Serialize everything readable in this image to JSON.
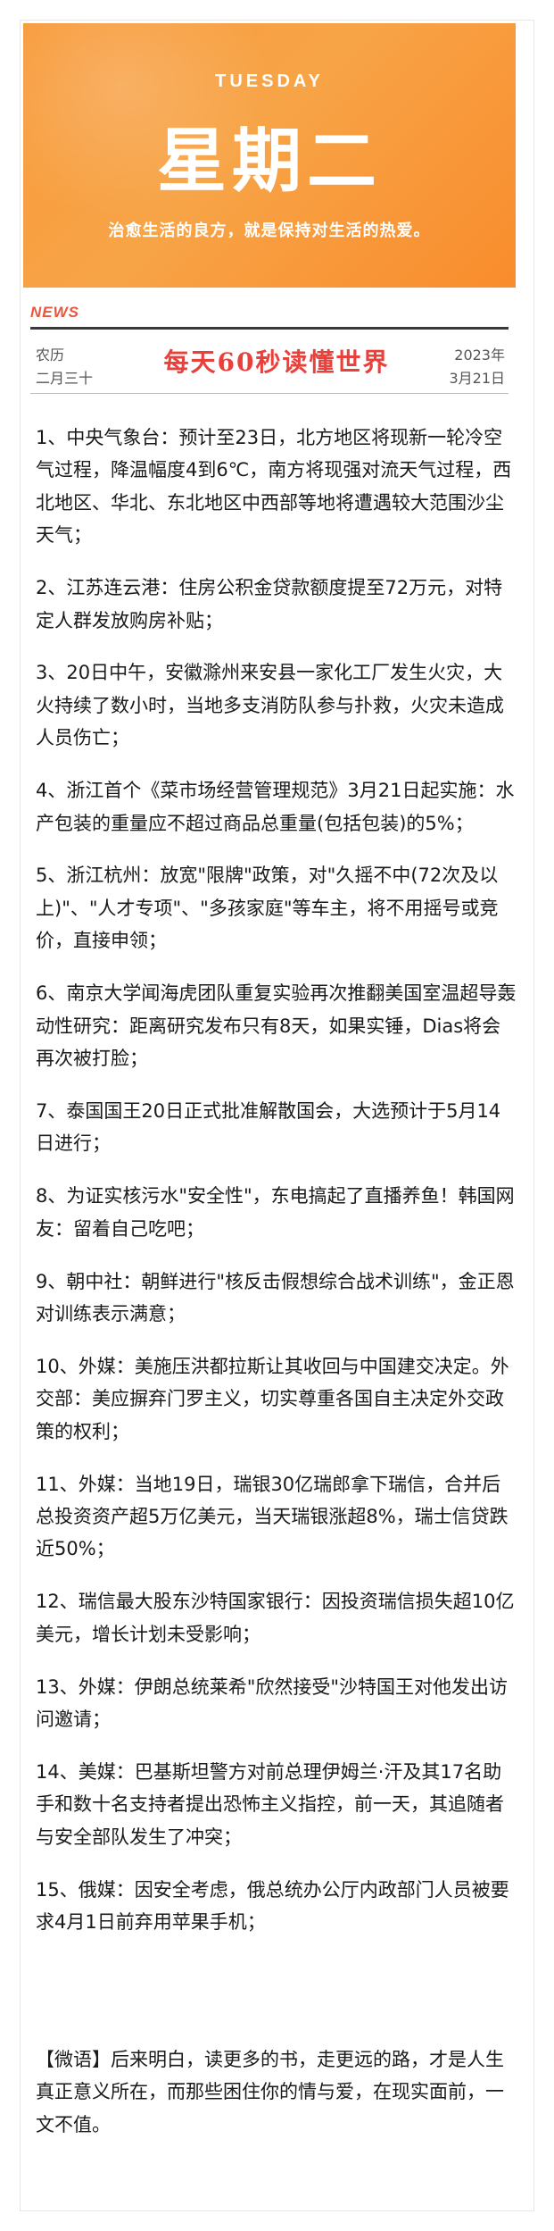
{
  "banner": {
    "day_en": "TUESDAY",
    "weekday": "星期二",
    "slogan": "治愈生活的良方，就是保持对生活的热爱。",
    "color": "#f89a3a"
  },
  "header": {
    "news_tag": "NEWS",
    "lunar_label": "农历",
    "lunar_date": "二月三十",
    "masthead": "每天60秒读懂世界",
    "year": "2023年",
    "month_day": "3月21日",
    "accent_color": "#e8413c"
  },
  "items": [
    "1、中央气象台：预计至23日，北方地区将现新一轮冷空气过程，降温幅度4到6℃，南方将现强对流天气过程，西北地区、华北、东北地区中西部等地将遭遇较大范围沙尘天气；",
    "2、江苏连云港：住房公积金贷款额度提至72万元，对特定人群发放购房补贴；",
    "3、20日中午，安徽滁州来安县一家化工厂发生火灾，大火持续了数小时，当地多支消防队参与扑救，火灾未造成人员伤亡；",
    "4、浙江首个《菜市场经营管理规范》3月21日起实施：水产包装的重量应不超过商品总重量(包括包装)的5%；",
    "5、浙江杭州：放宽\"限牌\"政策，对\"久摇不中(72次及以上)\"、\"人才专项\"、\"多孩家庭\"等车主，将不用摇号或竞价，直接申领；",
    "6、南京大学闻海虎团队重复实验再次推翻美国室温超导轰动性研究：距离研究发布只有8天，如果实锤，Dias将会再次被打脸；",
    "7、泰国国王20日正式批准解散国会，大选预计于5月14日进行；",
    "8、为证实核污水\"安全性\"，东电搞起了直播养鱼！韩国网友：留着自己吃吧；",
    "9、朝中社：朝鲜进行\"核反击假想综合战术训练\"，金正恩对训练表示满意；",
    "10、外媒：美施压洪都拉斯让其收回与中国建交决定。外交部：美应摒弃门罗主义，切实尊重各国自主决定外交政策的权利；",
    "11、外媒：当地19日，瑞银30亿瑞郎拿下瑞信，合并后总投资资产超5万亿美元，当天瑞银涨超8%，瑞士信贷跌近50%；",
    "12、瑞信最大股东沙特国家银行：因投资瑞信损失超10亿美元，增长计划未受影响；",
    "13、外媒：伊朗总统莱希\"欣然接受\"沙特国王对他发出访问邀请；",
    "14、美媒：巴基斯坦警方对前总理伊姆兰·汗及其17名助手和数十名支持者提出恐怖主义指控，前一天，其追随者与安全部队发生了冲突；",
    "15、俄媒：因安全考虑，俄总统办公厅内政部门人员被要求4月1日前弃用苹果手机；"
  ],
  "quote": "【微语】后来明白，读更多的书，走更远的路，才是人生真正意义所在，而那些困住你的情与爱，在现实面前，一文不值。"
}
